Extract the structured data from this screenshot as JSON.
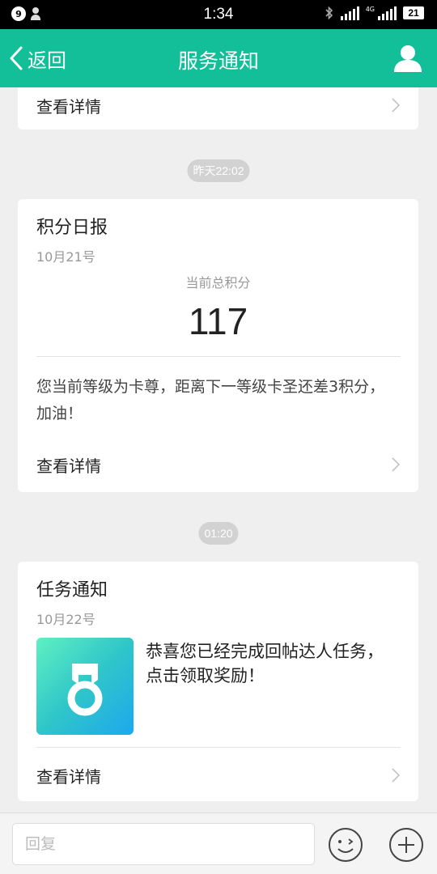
{
  "status_bar": {
    "notification_count": "9",
    "time": "1:34",
    "network_label": "4G",
    "battery": "21"
  },
  "nav": {
    "back_label": "返回",
    "title": "服务通知"
  },
  "cards": {
    "top": {
      "detail_label": "查看详情"
    },
    "points": {
      "timestamp": "昨天22:02",
      "title": "积分日报",
      "date": "10月21号",
      "score_label": "当前总积分",
      "score": "117",
      "message": "您当前等级为卡尊，距离下一等级卡圣还差3积分，加油！",
      "detail_label": "查看详情"
    },
    "task": {
      "timestamp": "01:20",
      "title": "任务通知",
      "date": "10月22号",
      "icon": "medal-icon",
      "message": "恭喜您已经完成回帖达人任务，点击领取奖励！",
      "detail_label": "查看详情"
    }
  },
  "reply": {
    "placeholder": "回复"
  },
  "colors": {
    "accent": "#12bf99",
    "background": "#efefef",
    "pill": "#d2d2d2"
  }
}
